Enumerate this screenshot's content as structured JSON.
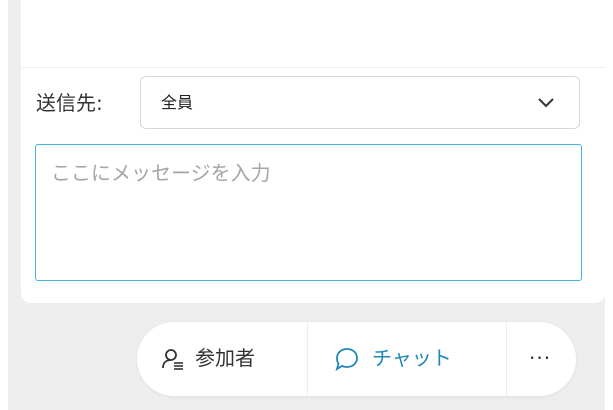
{
  "send_to": {
    "label": "送信先:",
    "selected": "全員"
  },
  "message": {
    "placeholder": "ここにメッセージを入力"
  },
  "toolbar": {
    "participants_label": "参加者",
    "chat_label": "チャット",
    "more_label": "···",
    "accent_color": "#1e87b5"
  }
}
